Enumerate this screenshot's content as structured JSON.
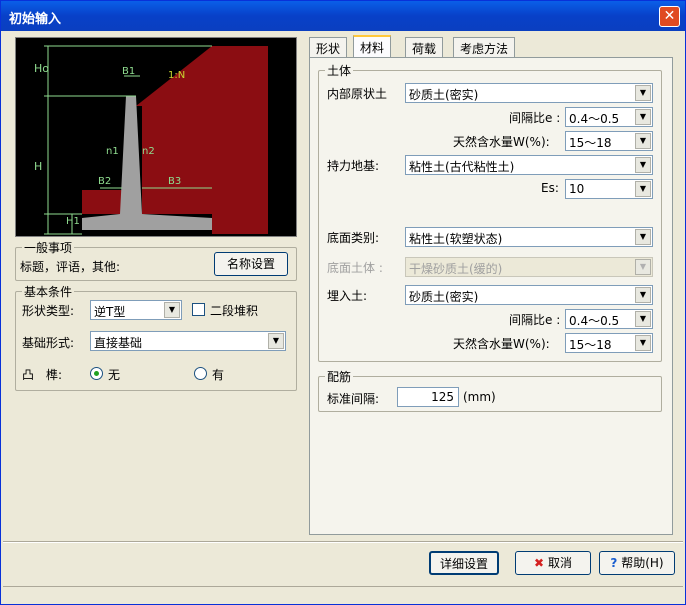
{
  "window": {
    "title": "初始输入",
    "close_glyph": "✕"
  },
  "preview": {
    "labels": {
      "Ho": "Ho",
      "H": "H",
      "H1": "H1",
      "B1": "B1",
      "B2": "B2",
      "B3": "B3",
      "slope": "1:N",
      "n1": "n1",
      "n2": "n2"
    },
    "colors": {
      "soil": "#8b0d12",
      "wall": "#a0a0a0",
      "dim": "#8fdc8f",
      "bg": "#000000"
    }
  },
  "general": {
    "legend": "一般事项",
    "text": "标题，评语，其他:",
    "name_button": "名称设置"
  },
  "basic": {
    "legend": "基本条件",
    "shape_label": "形状类型:",
    "shape_value": "逆T型",
    "two_stage_label": "二段堆积",
    "foundation_label": "基础形式:",
    "foundation_value": "直接基础",
    "tenon_label": "凸　榫:",
    "radio_none": "无",
    "radio_has": "有"
  },
  "tabs": [
    "形状",
    "材料",
    "荷载",
    "考虑方法"
  ],
  "soil": {
    "legend": "土体",
    "inner_label": "内部原状土",
    "inner_value": "砂质土(密实)",
    "void_label": "间隔比e :",
    "void_value": "0.4～0.5",
    "water_label": "天然含水量W(%):",
    "water_value": "15～18",
    "bearing_label": "持力地基:",
    "bearing_value": "粘性土(古代粘性土)",
    "es_label": "Es:",
    "es_value": "10",
    "bottom_label": "底面类别:",
    "bottom_value": "粘性土(软塑状态)",
    "bottom_soil_label": "底面土体 :",
    "bottom_soil_value": "干燥砂质土(缓的)",
    "backfill_label": "埋入土:",
    "backfill_value": "砂质土(密实)",
    "void2_label": "间隔比e :",
    "void2_value": "0.4～0.5",
    "water2_label": "天然含水量W(%):",
    "water2_value": "15～18"
  },
  "rebar": {
    "legend": "配筋",
    "spacing_label": "标准间隔:",
    "spacing_value": "125",
    "unit": "(mm)"
  },
  "footer": {
    "detail_button": "详细设置",
    "cancel_button": "取消",
    "help_button": "帮助(H)"
  }
}
